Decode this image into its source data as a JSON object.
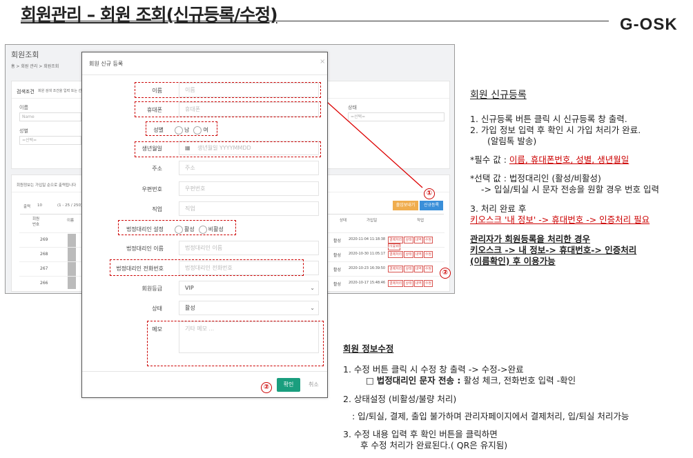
{
  "header": {
    "title": "회원관리 – 회원 조회(신규등록/수정)",
    "logo": "G-OSK"
  },
  "bg": {
    "title": "회원조회",
    "breadcrumb": "홈 > 회원 관리 > 회원조회",
    "search_label": "검색조건",
    "search_hint": "회원 검색 조건을 입력 또는 선택",
    "name_label": "이름",
    "name_placeholder": "Name",
    "gender_label": "성별",
    "gender_value": "=선택=",
    "status_label": "상태",
    "status_value": "=선택=",
    "list_info": "회원정보는 가입일 순으로 출력됩니다",
    "page_size": "10",
    "page_info": "(1 - 25 / 250)",
    "page_size_label": "출력",
    "btn_print": "출입보내기",
    "btn_new": "신규등록",
    "cols": [
      "회원번호",
      "이름",
      "상태",
      "가입일",
      "작업"
    ],
    "rows": [
      {
        "id": "269",
        "status": "활성",
        "date": "2020-11-04 11:18:38"
      },
      {
        "id": "268",
        "status": "활성",
        "date": "2020-10-30 11:05:17"
      },
      {
        "id": "267",
        "status": "활성",
        "date": "2020-10-23 16:39:50"
      },
      {
        "id": "266",
        "status": "활성",
        "date": "2020-10-17 15:48:46"
      }
    ],
    "tags": [
      "결제처리",
      "상태",
      "내역",
      "수정",
      "이용제"
    ]
  },
  "modal": {
    "title": "회원 신규 등록",
    "close": "×",
    "name_label": "이름",
    "name_ph": "이름",
    "phone_label": "휴대폰",
    "phone_ph": "휴대폰",
    "gender_label": "성별",
    "gender_m": "남",
    "gender_f": "여",
    "birth_label": "생년월일",
    "birth_ph": "생년월일 YYYYMMDD",
    "addr_label": "주소",
    "addr_ph": "주소",
    "zip_label": "우편번호",
    "zip_ph": "우편번호",
    "job_label": "직업",
    "job_ph": "직업",
    "guardian_label": "법정대리인 설정",
    "guardian_on": "활성",
    "guardian_off": "비활성",
    "gname_label": "법정대리인 이름",
    "gname_ph": "법정대리인 이름",
    "gphone_label": "법정대리인 전화번호",
    "gphone_ph": "법정대리인 전화번호",
    "grade_label": "회원등급",
    "grade_value": "VIP",
    "state_label": "상태",
    "state_value": "활성",
    "memo_label": "메모",
    "memo_ph": "기타 메모 ...",
    "confirm": "확인",
    "cancel": "취소"
  },
  "markers": {
    "one": "①",
    "two": "②"
  },
  "notes": {
    "reg_title": "회원 신규등록",
    "reg1": "1.   신규등록 버튼 클릭 시 신규등록 창 출력.",
    "reg2": "2.   가입 정보 입력 후 확인 시 가입 처리가 완료.",
    "reg2b": "(알림톡 발송)",
    "req_prefix": "*필수 값 : ",
    "req_values": "이름, 휴대폰번호, 성별, 생년월일",
    "opt1": "*선택 값 : 법정대리인 (활성/비활성)",
    "opt2": "-> 입실/퇴실 시 문자 전송을 원할 경우 번호 입력",
    "done_title": "3. 처리 완료 후",
    "done_red": "키오스크 '내 정보' -> 휴대번호 -> 인증처리 필요",
    "admin1": "관리자가 회원등록을 처리한 경우",
    "admin2": "키오스크 -> 내 정보-> 휴대번호-> 인증처리",
    "admin3": "(이름확인) 후 이용가능",
    "edit_title": "회원 정보수정",
    "edit1": "1.    수정 버튼 클릭 시 수정 창 출력 -> 수정->완료",
    "edit1b_prefix": "□ ",
    "edit1b_bold": "법정대리인 문자 전송 : ",
    "edit1b": "활성 체크,  전화번호 입력 -확인",
    "edit2": "2. 상태설정 (비활성/불량 처리)",
    "edit2b": ": 입/퇴실, 결제, 출입 불가하며 관리자페이지에서 결제처리, 입/퇴실 처리가능",
    "edit3": "3. 수정 내용 입력 후 확인 버튼을 클릭하면",
    "edit3b": "후 수정 처리가 완료된다.( QR은 유지됨)"
  },
  "colors": {
    "accent_red": "#cc0000",
    "confirm_green": "#1a9e7e",
    "btn_orange": "#f0ad4e",
    "btn_blue": "#3a8fd9"
  }
}
